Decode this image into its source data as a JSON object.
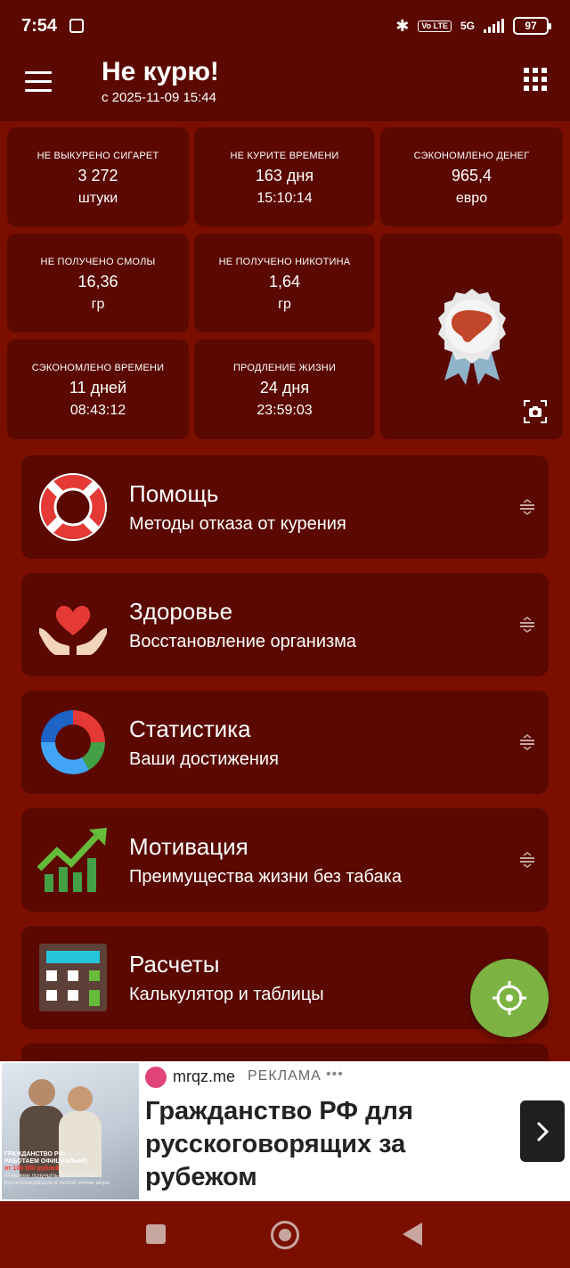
{
  "status_bar": {
    "time": "7:54",
    "network": "5G",
    "volte": "Vo LTE",
    "battery": "97"
  },
  "app_bar": {
    "title": "Не курю!",
    "subtitle": "с 2025-11-09 15:44"
  },
  "stats": [
    {
      "label": "НЕ ВЫКУРЕНО СИГАРЕТ",
      "value": "3 272",
      "unit": "штуки"
    },
    {
      "label": "НЕ КУРИТЕ ВРЕМЕНИ",
      "value": "163 дня",
      "unit": "15:10:14"
    },
    {
      "label": "СЭКОНОМЛЕНО ДЕНЕГ",
      "value": "965,4",
      "unit": "евро"
    },
    {
      "label": "НЕ ПОЛУЧЕНО СМОЛЫ",
      "value": "16,36",
      "unit": "гр"
    },
    {
      "label": "НЕ ПОЛУЧЕНО НИКОТИНА",
      "value": "1,64",
      "unit": "гр"
    },
    {
      "label": "СЭКОНОМЛЕНО ВРЕМЕНИ",
      "value": "11 дней",
      "unit": "08:43:12"
    },
    {
      "label": "ПРОДЛЕНИЕ ЖИЗНИ",
      "value": "24 дня",
      "unit": "23:59:03"
    }
  ],
  "menu": [
    {
      "title": "Помощь",
      "subtitle": "Методы отказа от курения",
      "icon": "lifebuoy-icon"
    },
    {
      "title": "Здоровье",
      "subtitle": "Восстановление организма",
      "icon": "heart-hands-icon"
    },
    {
      "title": "Статистика",
      "subtitle": "Ваши достижения",
      "icon": "donut-chart-icon"
    },
    {
      "title": "Мотивация",
      "subtitle": "Преимущества жизни без табака",
      "icon": "growth-chart-icon"
    },
    {
      "title": "Расчеты",
      "subtitle": "Калькулятор и таблицы",
      "icon": "calculator-icon"
    }
  ],
  "ad": {
    "domain": "mrqz.me",
    "tag": "РЕКЛАМА",
    "more": "•••",
    "headline": "Гражданство РФ для русскоговорящих за рубежом",
    "image_text_1": "ГРАЖДАНСТВО РФ:",
    "image_text_2": "РАБОТАЕМ ОФИЦИАЛЬНО",
    "image_text_3": "от 100 000 рублей",
    "image_text_4": "Поможем получить гражданство русскоговорящим в любой точке мира"
  },
  "colors": {
    "background": "#7a0f00",
    "panel": "#5a0800",
    "fab": "#7cb342"
  }
}
